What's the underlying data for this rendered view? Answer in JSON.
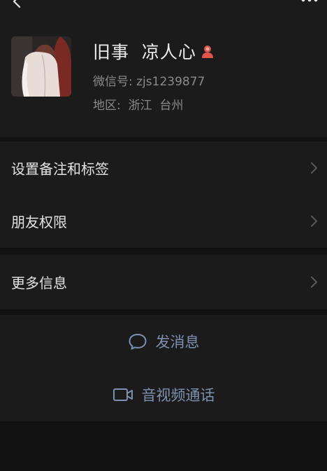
{
  "profile": {
    "nickname": "旧事  凉人心",
    "wechat_id": "微信号: zjs1239877",
    "region": "地区:  浙江  台州",
    "gender": "female",
    "gender_color": "#e0524a"
  },
  "menu": {
    "remark_label": "设置备注和标签",
    "permissions_label": "朋友权限",
    "more_info_label": "更多信息"
  },
  "actions": {
    "message_label": "发消息",
    "call_label": "音视频通话",
    "accent_color": "#7d90ad"
  },
  "icons": {
    "back": "back-arrow-icon",
    "more": "more-dots-icon",
    "chevron": "chevron-right-icon",
    "message": "chat-bubble-icon",
    "call": "video-camera-icon",
    "gender": "female-gender-icon"
  }
}
